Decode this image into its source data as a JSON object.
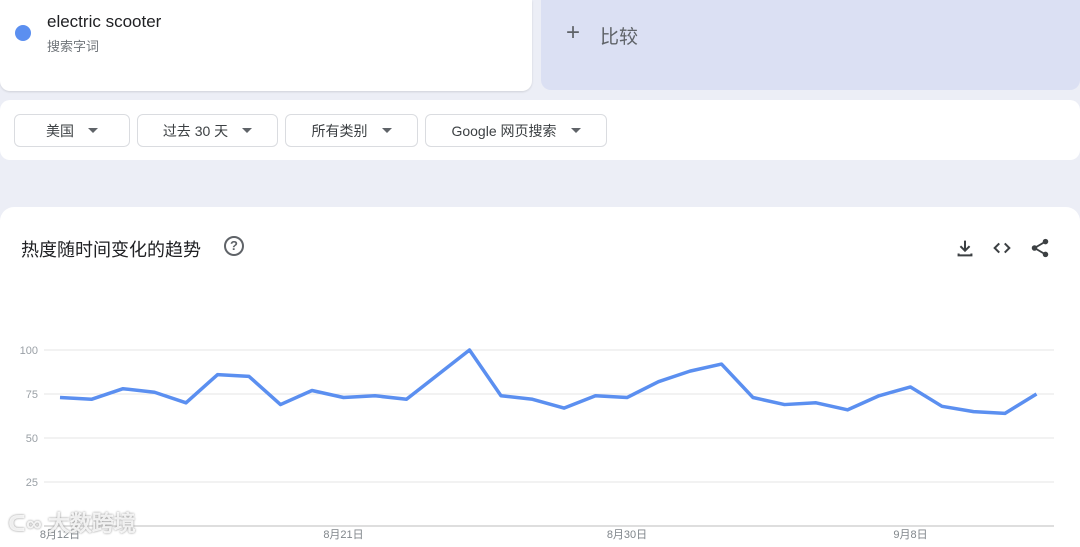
{
  "term": {
    "name": "electric scooter",
    "type": "搜索字词",
    "color": "#5b8ff0"
  },
  "compare": {
    "icon": "plus-icon",
    "label": "比较"
  },
  "filters": [
    {
      "label": "美国"
    },
    {
      "label": "过去 30 天"
    },
    {
      "label": "所有类别"
    },
    {
      "label": "Google 网页搜索"
    }
  ],
  "chart_card": {
    "title": "热度随时间变化的趋势",
    "help": "?",
    "icons": [
      "download-icon",
      "embed-code-icon",
      "share-icon"
    ]
  },
  "watermark": "大数跨境",
  "chart_data": {
    "type": "line",
    "title": "热度随时间变化的趋势",
    "xlabel": "",
    "ylabel": "",
    "ylim": [
      0,
      100
    ],
    "yticks": [
      25,
      50,
      75,
      100
    ],
    "xtick_labels": [
      {
        "index": 0,
        "label": "8月12日"
      },
      {
        "index": 9,
        "label": "8月21日"
      },
      {
        "index": 18,
        "label": "8月30日"
      },
      {
        "index": 27,
        "label": "9月8日"
      }
    ],
    "grid": true,
    "series": [
      {
        "name": "electric scooter",
        "color": "#5b8ff0",
        "values": [
          73,
          72,
          78,
          76,
          70,
          86,
          85,
          69,
          77,
          73,
          74,
          72,
          86,
          100,
          74,
          72,
          67,
          74,
          73,
          82,
          88,
          92,
          73,
          69,
          70,
          66,
          74,
          79,
          68,
          65,
          64,
          75
        ]
      }
    ]
  }
}
